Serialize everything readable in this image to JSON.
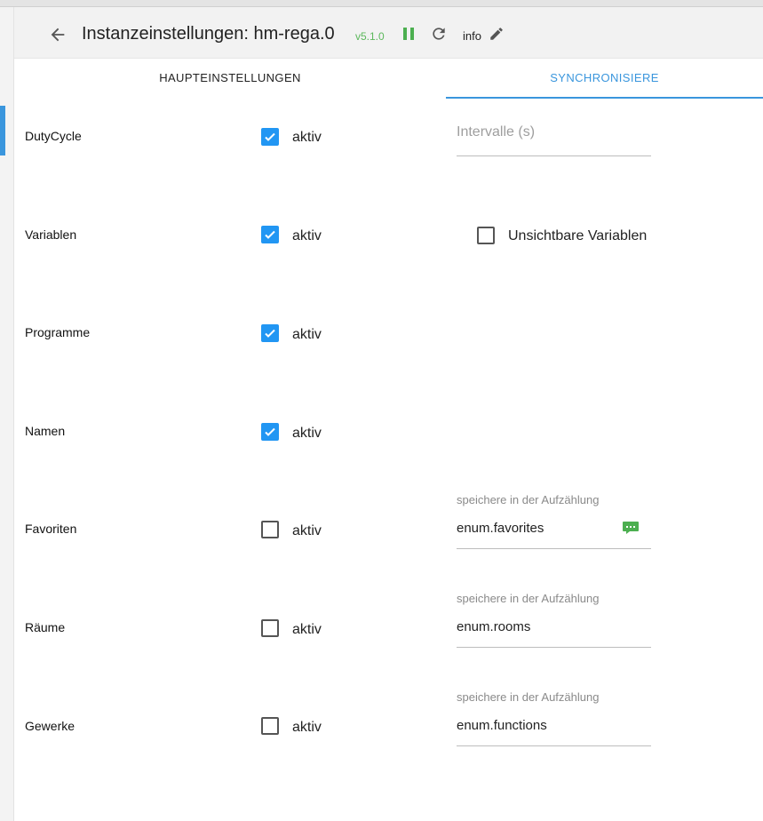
{
  "header": {
    "title": "Instanzeinstellungen: hm-rega.0",
    "version": "v5.1.0",
    "info_label": "info"
  },
  "tabs": [
    {
      "label": "HAUPTEINSTELLUNGEN",
      "active": false
    },
    {
      "label": "SYNCHRONISIERE",
      "active": true
    }
  ],
  "rows": [
    {
      "label": "DutyCycle",
      "checked": true,
      "checkbox_label": "aktiv"
    },
    {
      "label": "Variablen",
      "checked": true,
      "checkbox_label": "aktiv"
    },
    {
      "label": "Programme",
      "checked": true,
      "checkbox_label": "aktiv"
    },
    {
      "label": "Namen",
      "checked": true,
      "checkbox_label": "aktiv"
    },
    {
      "label": "Favoriten",
      "checked": false,
      "checkbox_label": "aktiv"
    },
    {
      "label": "Räume",
      "checked": false,
      "checkbox_label": "aktiv"
    },
    {
      "label": "Gewerke",
      "checked": false,
      "checkbox_label": "aktiv"
    }
  ],
  "interval_field": {
    "placeholder": "Intervalle (s)"
  },
  "invisible_vars": {
    "label": "Unsichtbare Variablen",
    "checked": false
  },
  "enum_fields": [
    {
      "label": "speichere in der Aufzählung",
      "value": "enum.favorites"
    },
    {
      "label": "speichere in der Aufzählung",
      "value": "enum.rooms"
    },
    {
      "label": "speichere in der Aufzählung",
      "value": "enum.functions"
    }
  ],
  "colors": {
    "accent": "#3a96dd",
    "checkbox": "#2196f3",
    "version": "#5cb85c",
    "pause": "#4caf50",
    "chat": "#4caf50"
  }
}
